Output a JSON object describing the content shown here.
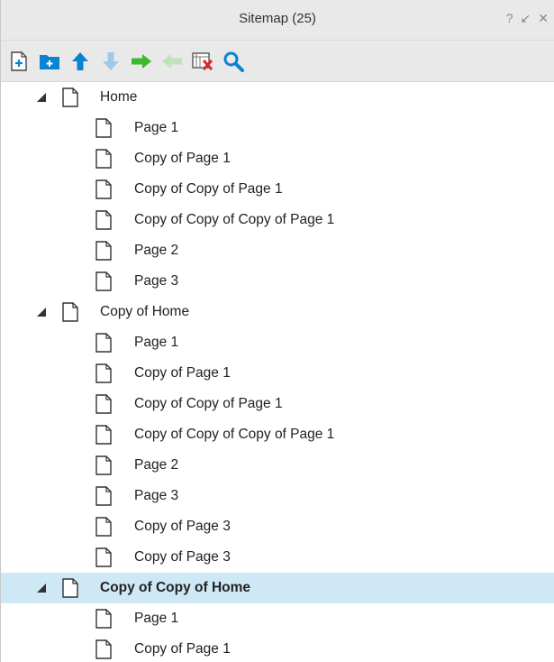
{
  "panel": {
    "title": "Sitemap (25)",
    "controls": {
      "help": "?",
      "dock": "↙",
      "close": "✕"
    }
  },
  "toolbar": {
    "tools": [
      {
        "name": "add-page-icon"
      },
      {
        "name": "add-folder-icon"
      },
      {
        "name": "move-up-icon"
      },
      {
        "name": "move-down-icon"
      },
      {
        "name": "indent-icon"
      },
      {
        "name": "outdent-icon"
      },
      {
        "name": "delete-icon"
      },
      {
        "name": "search-icon"
      }
    ]
  },
  "colors": {
    "accent": "#0a84d0",
    "green": "#3cb92c",
    "selected": "#cfe8f6",
    "delete": "#d9272e"
  },
  "tree": [
    {
      "label": "Home",
      "root": true
    },
    {
      "label": "Page 1"
    },
    {
      "label": "Copy of Page 1"
    },
    {
      "label": "Copy of Copy of Page 1"
    },
    {
      "label": "Copy of Copy of Copy of Page 1"
    },
    {
      "label": "Page 2"
    },
    {
      "label": "Page 3"
    },
    {
      "label": "Copy of Home",
      "root": true
    },
    {
      "label": "Page 1"
    },
    {
      "label": "Copy of Page 1"
    },
    {
      "label": "Copy of Copy of Page 1"
    },
    {
      "label": "Copy of Copy of Copy of Page 1"
    },
    {
      "label": "Page 2"
    },
    {
      "label": "Page 3"
    },
    {
      "label": "Copy of Page 3"
    },
    {
      "label": "Copy of Page 3"
    },
    {
      "label": "Copy of Copy of Home",
      "root": true,
      "selected": true
    },
    {
      "label": "Page 1"
    },
    {
      "label": "Copy of Page 1"
    }
  ]
}
